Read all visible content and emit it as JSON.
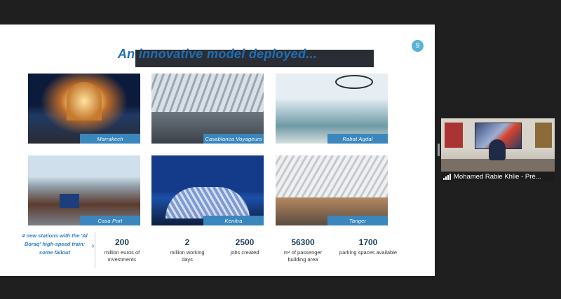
{
  "slide": {
    "title": "An innovative model deployed...",
    "page_number": "9",
    "photos": [
      {
        "label": "Marrakech"
      },
      {
        "label": "Casablanca Voyageurs"
      },
      {
        "label": "Rabat Agdal"
      },
      {
        "label": "Casa Port"
      },
      {
        "label": "Kenitra"
      },
      {
        "label": "Tanger"
      }
    ],
    "callout": "4 new stations with the 'Al Boraq' high-speed train: some fallout",
    "stats": [
      {
        "value": "200",
        "text": "million euros of investments"
      },
      {
        "value": "2",
        "text": "million working days"
      },
      {
        "value": "2500",
        "text": "jobs created"
      },
      {
        "value": "56300",
        "text": "m² of passenger building area"
      },
      {
        "value": "1700",
        "text": "parking spaces available"
      }
    ]
  },
  "participant": {
    "name": "Mohamed Rabie Khlie - Pré..."
  }
}
